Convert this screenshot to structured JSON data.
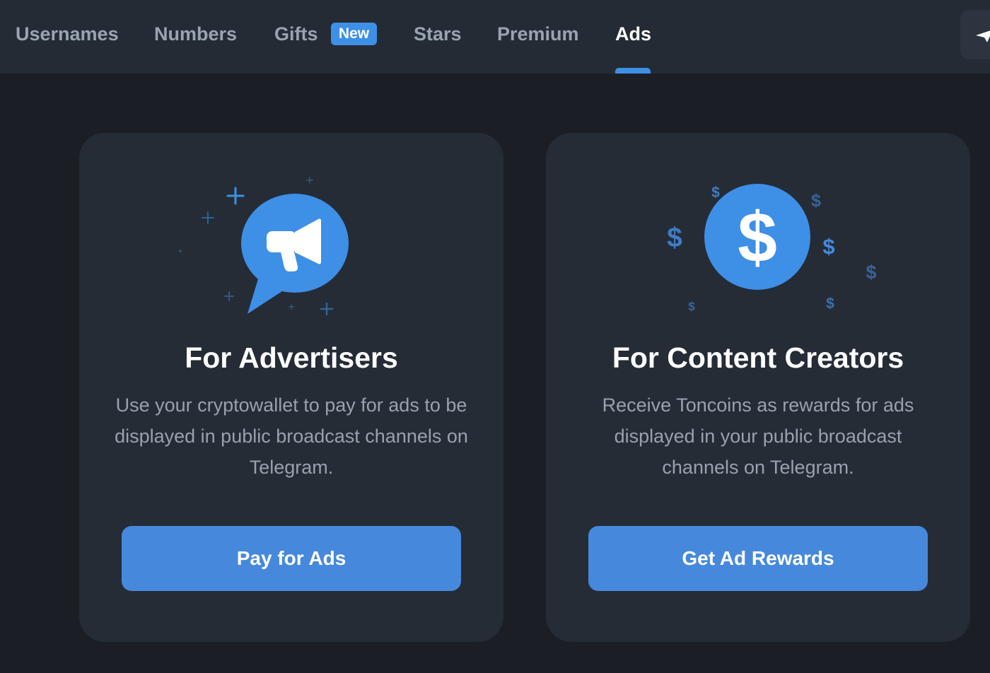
{
  "nav": {
    "tabs": [
      {
        "label": "Usernames"
      },
      {
        "label": "Numbers"
      },
      {
        "label": "Gifts",
        "badge": "New"
      },
      {
        "label": "Stars"
      },
      {
        "label": "Premium"
      },
      {
        "label": "Ads",
        "active": true
      }
    ],
    "corner_icon": "telegram-paper-plane-icon"
  },
  "cards": [
    {
      "icon": "megaphone-speech-bubble-icon",
      "title": "For Advertisers",
      "description": "Use your cryptowallet to pay for ads to be displayed in public broadcast channels on Telegram.",
      "button": "Pay for Ads"
    },
    {
      "icon": "dollar-coin-icon",
      "title": "For Content Creators",
      "description": "Receive Toncoins as rewards for ads displayed in your public broadcast channels on Telegram.",
      "button": "Get Ad Rewards"
    }
  ],
  "colors": {
    "page_background": "#1b1f25",
    "topbar": "#242b35",
    "card": "#252c36",
    "accent": "#3e8fe6",
    "button": "#4689dc",
    "muted_text": "#98a2ae"
  }
}
